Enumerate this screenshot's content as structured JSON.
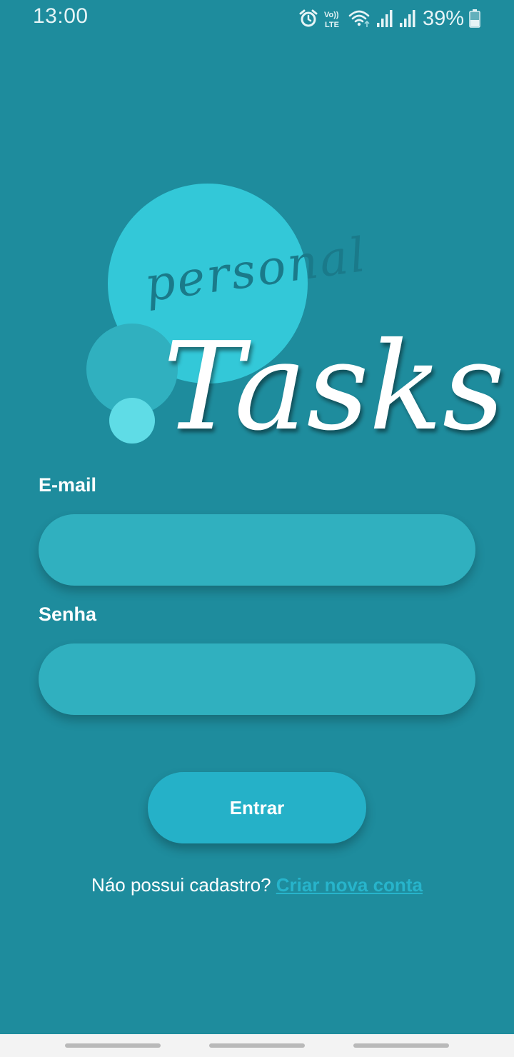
{
  "status_bar": {
    "time": "13:00",
    "battery": "39%",
    "volte_top": "Vo))",
    "volte_bottom": "LTE",
    "icons": [
      "alarm-icon",
      "volte-icon",
      "wifi-icon",
      "signal-icon",
      "signal-icon",
      "battery-icon"
    ]
  },
  "logo": {
    "word_top": "personal",
    "word_bottom": "Tasks"
  },
  "form": {
    "email_label": "E-mail",
    "email_value": "",
    "password_label": "Senha",
    "password_value": "",
    "submit_label": "Entrar"
  },
  "signup": {
    "prompt": "Náo possui cadastro?",
    "link_label": "Criar nova conta"
  },
  "colors": {
    "background": "#1e8c9d",
    "input_fill": "#30b0bf",
    "button_fill": "#25b1c8",
    "link": "#27b4cb",
    "logo_circle_large": "#33c8d8",
    "logo_circle_medium": "#30b0bf",
    "logo_circle_small": "#5fdce6"
  }
}
